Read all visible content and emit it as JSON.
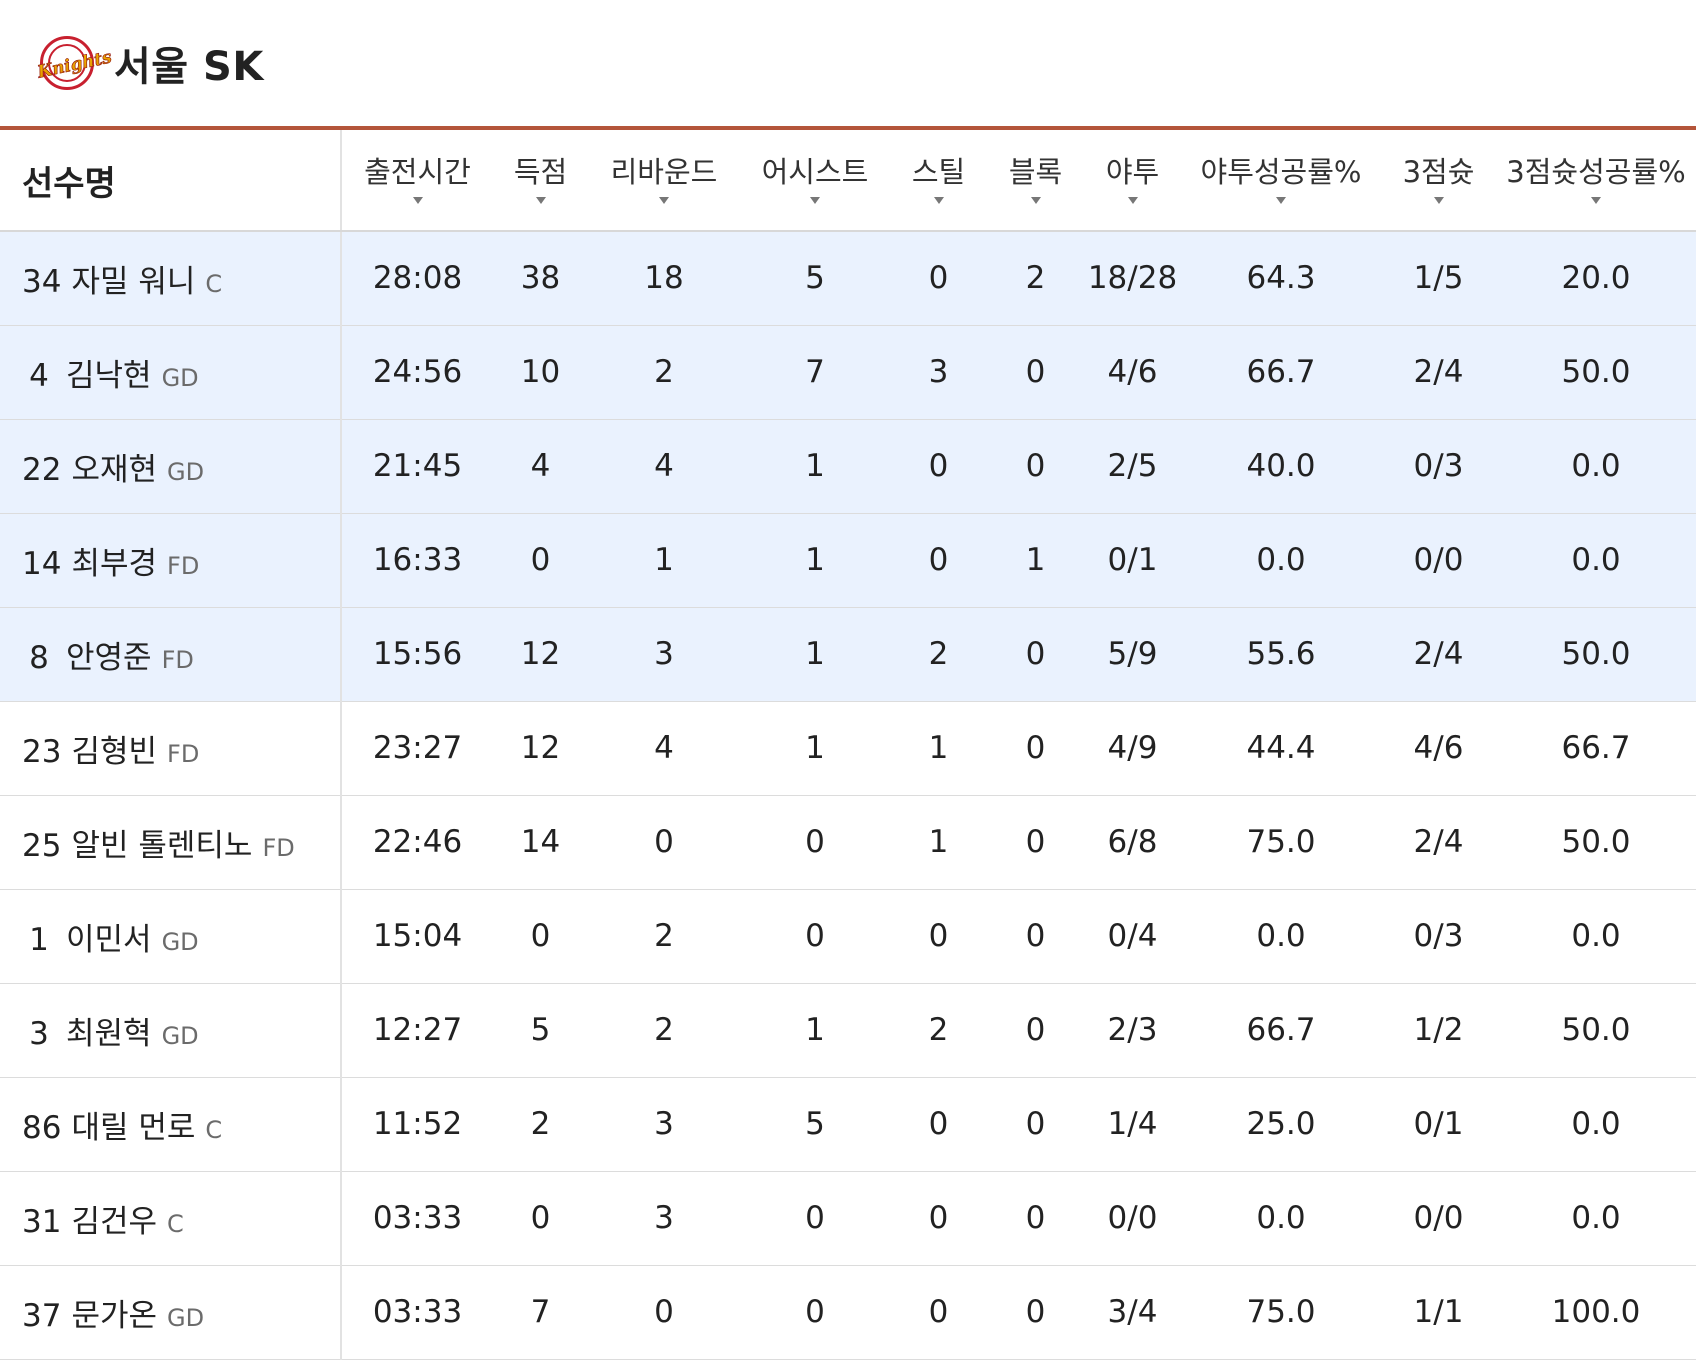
{
  "team": {
    "name": "서울 SK",
    "logo_text": "Knights"
  },
  "columns": {
    "player": "선수명",
    "stats": [
      "출전시간",
      "득점",
      "리바운드",
      "어시스트",
      "스틸",
      "블록",
      "야투",
      "야투성공률%",
      "3점슛",
      "3점슛성공률%"
    ]
  },
  "players": [
    {
      "number": "34",
      "name": "자밀 워니",
      "position": "C",
      "starter": true,
      "stats": [
        "28:08",
        "38",
        "18",
        "5",
        "0",
        "2",
        "18/28",
        "64.3",
        "1/5",
        "20.0"
      ]
    },
    {
      "number": "4",
      "name": "김낙현",
      "position": "GD",
      "starter": true,
      "stats": [
        "24:56",
        "10",
        "2",
        "7",
        "3",
        "0",
        "4/6",
        "66.7",
        "2/4",
        "50.0"
      ]
    },
    {
      "number": "22",
      "name": "오재현",
      "position": "GD",
      "starter": true,
      "stats": [
        "21:45",
        "4",
        "4",
        "1",
        "0",
        "0",
        "2/5",
        "40.0",
        "0/3",
        "0.0"
      ]
    },
    {
      "number": "14",
      "name": "최부경",
      "position": "FD",
      "starter": true,
      "stats": [
        "16:33",
        "0",
        "1",
        "1",
        "0",
        "1",
        "0/1",
        "0.0",
        "0/0",
        "0.0"
      ]
    },
    {
      "number": "8",
      "name": "안영준",
      "position": "FD",
      "starter": true,
      "stats": [
        "15:56",
        "12",
        "3",
        "1",
        "2",
        "0",
        "5/9",
        "55.6",
        "2/4",
        "50.0"
      ]
    },
    {
      "number": "23",
      "name": "김형빈",
      "position": "FD",
      "starter": false,
      "stats": [
        "23:27",
        "12",
        "4",
        "1",
        "1",
        "0",
        "4/9",
        "44.4",
        "4/6",
        "66.7"
      ]
    },
    {
      "number": "25",
      "name": "알빈 톨렌티노",
      "position": "FD",
      "starter": false,
      "stats": [
        "22:46",
        "14",
        "0",
        "0",
        "1",
        "0",
        "6/8",
        "75.0",
        "2/4",
        "50.0"
      ]
    },
    {
      "number": "1",
      "name": "이민서",
      "position": "GD",
      "starter": false,
      "stats": [
        "15:04",
        "0",
        "2",
        "0",
        "0",
        "0",
        "0/4",
        "0.0",
        "0/3",
        "0.0"
      ]
    },
    {
      "number": "3",
      "name": "최원혁",
      "position": "GD",
      "starter": false,
      "stats": [
        "12:27",
        "5",
        "2",
        "1",
        "2",
        "0",
        "2/3",
        "66.7",
        "1/2",
        "50.0"
      ]
    },
    {
      "number": "86",
      "name": "대릴 먼로",
      "position": "C",
      "starter": false,
      "stats": [
        "11:52",
        "2",
        "3",
        "5",
        "0",
        "0",
        "1/4",
        "25.0",
        "0/1",
        "0.0"
      ]
    },
    {
      "number": "31",
      "name": "김건우",
      "position": "C",
      "starter": false,
      "stats": [
        "03:33",
        "0",
        "3",
        "0",
        "0",
        "0",
        "0/0",
        "0.0",
        "0/0",
        "0.0"
      ]
    },
    {
      "number": "37",
      "name": "문가온",
      "position": "GD",
      "starter": false,
      "stats": [
        "03:33",
        "7",
        "0",
        "0",
        "0",
        "0",
        "3/4",
        "75.0",
        "1/1",
        "100.0"
      ]
    }
  ],
  "colors": {
    "accent_line": "#b4553a",
    "starter_row_bg": "#eaf2fe",
    "logo_red": "#c8202f"
  }
}
